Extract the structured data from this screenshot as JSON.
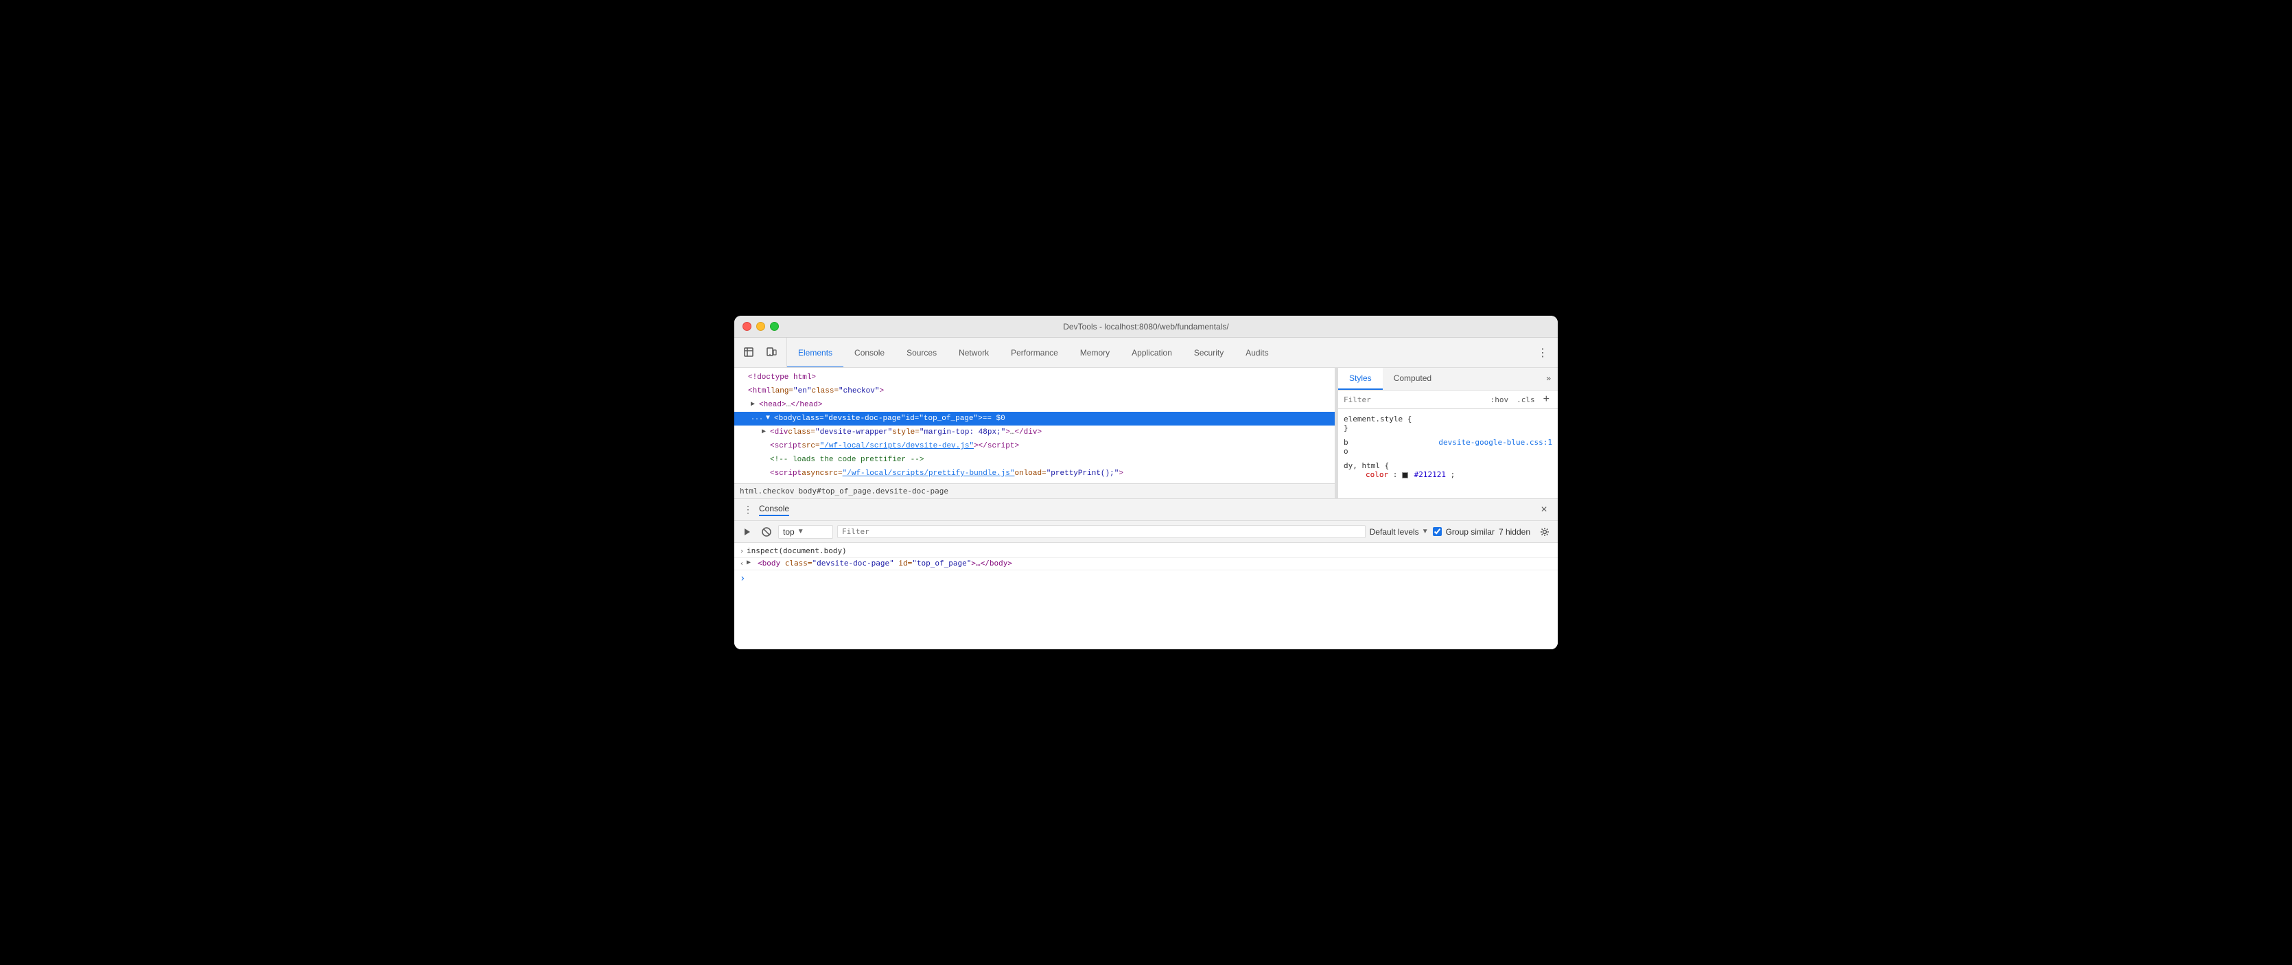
{
  "window": {
    "title": "DevTools - localhost:8080/web/fundamentals/"
  },
  "traffic_lights": {
    "red": "close",
    "yellow": "minimize",
    "green": "fullscreen"
  },
  "toolbar": {
    "tabs": [
      {
        "id": "elements",
        "label": "Elements",
        "active": true
      },
      {
        "id": "console",
        "label": "Console",
        "active": false
      },
      {
        "id": "sources",
        "label": "Sources",
        "active": false
      },
      {
        "id": "network",
        "label": "Network",
        "active": false
      },
      {
        "id": "performance",
        "label": "Performance",
        "active": false
      },
      {
        "id": "memory",
        "label": "Memory",
        "active": false
      },
      {
        "id": "application",
        "label": "Application",
        "active": false
      },
      {
        "id": "security",
        "label": "Security",
        "active": false
      },
      {
        "id": "audits",
        "label": "Audits",
        "active": false
      }
    ]
  },
  "elements": {
    "lines": [
      {
        "indent": 0,
        "content": "&lt;!doctype html&gt;",
        "type": "doctype"
      },
      {
        "indent": 0,
        "content": "<html>",
        "type": "tag"
      },
      {
        "indent": 1,
        "content": "<head>",
        "type": "tag",
        "collapsed": true
      },
      {
        "indent": 1,
        "content": "<body>",
        "type": "tag",
        "selected": true
      },
      {
        "indent": 2,
        "content": "<div>",
        "type": "tag"
      },
      {
        "indent": 2,
        "content": "<script>",
        "type": "tag"
      },
      {
        "indent": 2,
        "content": "<!-- comment -->",
        "type": "comment"
      },
      {
        "indent": 2,
        "content": "<script async>",
        "type": "tag"
      }
    ],
    "selected_line_text": "... ▼ <body class=\"devsite-doc-page\" id=\"top_of_page\"> == $0"
  },
  "breadcrumb": {
    "items": [
      {
        "label": "html.checkov"
      },
      {
        "label": "body#top_of_page.devsite-doc-page"
      }
    ]
  },
  "styles": {
    "tabs": [
      {
        "id": "styles",
        "label": "Styles",
        "active": true
      },
      {
        "id": "computed",
        "label": "Computed",
        "active": false
      }
    ],
    "filter_placeholder": "Filter",
    "filter_hov": ":hov",
    "filter_cls": ".cls",
    "rules": [
      {
        "selector": "element.style {",
        "closing": "}",
        "source": "",
        "props": []
      },
      {
        "selector": "b",
        "source": "devsite-google-blue.css:1",
        "source_suffix": "o",
        "closing": "",
        "props": []
      },
      {
        "selector": "dy, html {",
        "closing": "}",
        "source": "",
        "props": [
          {
            "name": "color",
            "value": "#212121",
            "color_swatch": "#212121"
          }
        ]
      }
    ]
  },
  "console_drawer": {
    "title": "Console",
    "close_label": "×",
    "toolbar": {
      "execute_label": "▶",
      "clear_label": "🚫",
      "context_value": "top",
      "filter_placeholder": "Filter",
      "levels_label": "Default levels",
      "group_similar_label": "Group similar",
      "hidden_count": "7 hidden"
    },
    "lines": [
      {
        "type": "input",
        "chevron": "›",
        "text": "inspect(document.body)"
      },
      {
        "type": "output",
        "chevron": "‹",
        "text": "<body class=\"devsite-doc-page\" id=\"top_of_page\">…</body>"
      }
    ],
    "prompt_symbol": ">"
  }
}
